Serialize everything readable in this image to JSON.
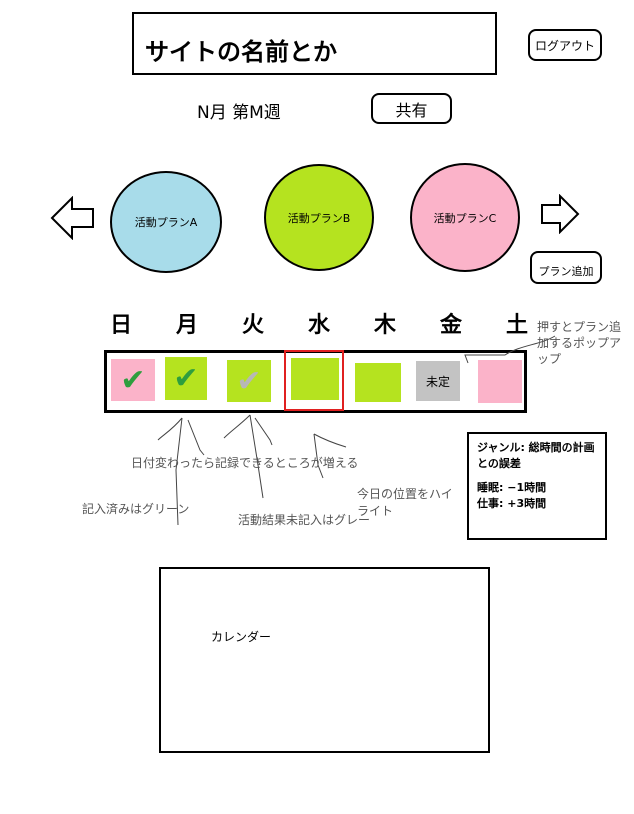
{
  "header": {
    "site_name": "サイトの名前とか",
    "logout_label": "ログアウト"
  },
  "week_bar": {
    "week_label": "N月 第M週",
    "share_label": "共有"
  },
  "plans": {
    "items": [
      {
        "label": "活動プランA",
        "color": "#a8dcea"
      },
      {
        "label": "活動プランB",
        "color": "#b5e31f"
      },
      {
        "label": "活動プランC",
        "color": "#fbb3c9"
      }
    ],
    "add_label": "プラン追加",
    "prev_icon": "arrow-left-icon",
    "next_icon": "arrow-right-icon"
  },
  "days": [
    "日",
    "月",
    "火",
    "水",
    "木",
    "金",
    "土"
  ],
  "day_cells": [
    {
      "state": "done",
      "color": "#fbb3c9",
      "check_color": "#2e9e3e"
    },
    {
      "state": "done",
      "color": "#b5e31f",
      "check_color": "#2e9e3e"
    },
    {
      "state": "unrecorded",
      "color": "#b5e31f",
      "check_color": "#b7b7b7"
    },
    {
      "state": "today",
      "color": "#b5e31f",
      "highlight_color": "#e02020"
    },
    {
      "state": "future",
      "color": "#b5e31f"
    },
    {
      "state": "undecided",
      "color": "#c3c3c3",
      "label": "未定"
    },
    {
      "state": "future",
      "color": "#fbb3c9"
    }
  ],
  "annotations": {
    "add_plan_popup": "押すとプラン追加するポップアップ",
    "recordable_increase": "日付変わったら記録できるところが増える",
    "recorded_green": "記入済みはグリーン",
    "unrecorded_gray": "活動結果未記入はグレー",
    "today_highlight": "今日の位置をハイライト"
  },
  "stats": {
    "title": "ジャンル: 総時間の計画との誤差",
    "rows": [
      {
        "label": "睡眠:",
        "value": "−1時間"
      },
      {
        "label": "仕事:",
        "value": "+3時間"
      }
    ]
  },
  "calendar": {
    "label": "カレンダー"
  }
}
